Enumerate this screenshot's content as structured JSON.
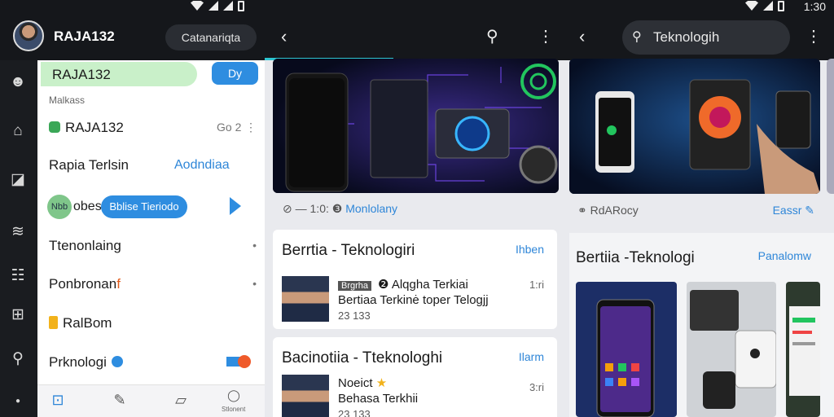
{
  "left": {
    "username": "RAJA132",
    "pill": "Catanariqta",
    "drawer": {
      "header": "RAJA132",
      "header_button": "Dy",
      "small_label": "Malkass",
      "row_account": "RAJA132",
      "row_account_right": "Go 2",
      "row_latest": "Rapia Terlsin",
      "row_latest_link": "Aodndiaa",
      "sb_circle": "Nbb",
      "sb_label": "obes",
      "sb_chip": "Bblise Tieriodo",
      "row_tech": "Ttenonlaing",
      "row_pon": "Ponbronan",
      "row_pon_mark": "f",
      "row_ralbom": "RalBom",
      "row_pk": "Prknologi",
      "nav_label": "Stlonent"
    }
  },
  "middle": {
    "meta_prefix": "— 1:0:",
    "meta_link": "Monlolany",
    "card1": {
      "title": "Berrtia - Teknologiri",
      "link": "Ihben",
      "tag": "Brgrha",
      "line1": "Alqgha Terkiai",
      "line2": "Bertiaa Terkinė toper Telogjj",
      "line3": "23 133",
      "time": "1:ri"
    },
    "card2": {
      "title": "Bacinotiia - Tteknologhi",
      "link": "Ilarm",
      "line1": "Noeict",
      "line2": "Behasa Terkhii",
      "line3": "23 133",
      "time": "3:ri"
    }
  },
  "right": {
    "time": "1:30",
    "search": "Teknologih",
    "meta": "RdARocy",
    "meta_link": "Eassr",
    "card_title": "Bertiia -Teknologi",
    "card_link": "Panalomw"
  },
  "colors": {
    "accent": "#2e8de0",
    "progress": "#2dc5d0",
    "topbar": "#15171b",
    "rail": "#1a1c20"
  }
}
